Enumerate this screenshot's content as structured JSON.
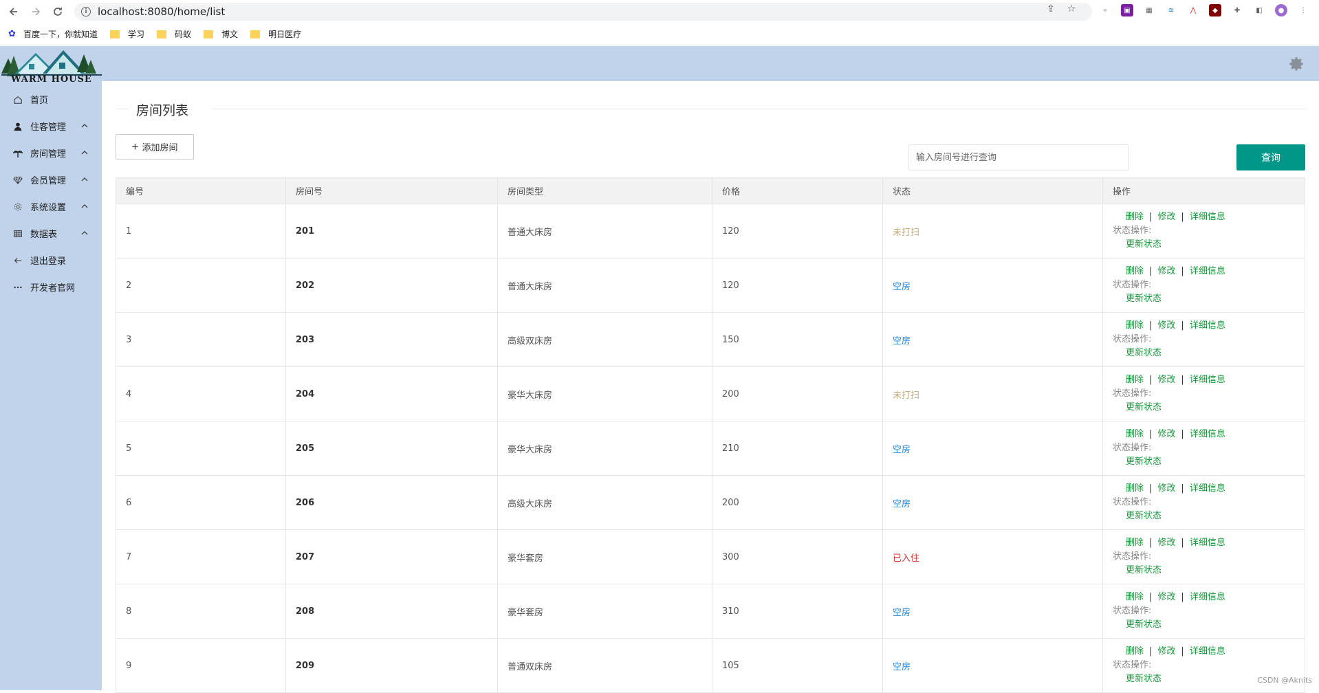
{
  "browser": {
    "url": "localhost:8080/home/list",
    "bookmarks": [
      "百度一下，你就知道",
      "学习",
      "码蚁",
      "博文",
      "明日医疗"
    ]
  },
  "app": {
    "logo_text": "WARM HOUSE"
  },
  "sidebar": {
    "items": [
      {
        "label": "首页",
        "icon": "home-icon"
      },
      {
        "label": "住客管理",
        "icon": "user-icon"
      },
      {
        "label": "房间管理",
        "icon": "palm-icon"
      },
      {
        "label": "会员管理",
        "icon": "diamond-icon"
      },
      {
        "label": "系统设置",
        "icon": "gear-icon"
      },
      {
        "label": "数据表",
        "icon": "table-icon"
      },
      {
        "label": "退出登录",
        "icon": "arrow-left-icon"
      },
      {
        "label": "开发者官网",
        "icon": "more-icon"
      }
    ]
  },
  "main": {
    "title": "房间列表",
    "add_button": "添加房间",
    "search_placeholder": "输入房间号进行查询",
    "search_button": "查询",
    "columns": [
      "编号",
      "房间号",
      "房间类型",
      "价格",
      "状态",
      "操作"
    ],
    "ops": {
      "delete": "删除",
      "edit": "修改",
      "detail": "详细信息",
      "state_label": "状态操作:",
      "update": "更新状态"
    },
    "rows": [
      {
        "id": "1",
        "room": "201",
        "type": "普通大床房",
        "price": "120",
        "status": "未打扫",
        "cls": "st-dirty"
      },
      {
        "id": "2",
        "room": "202",
        "type": "普通大床房",
        "price": "120",
        "status": "空房",
        "cls": "st-empty"
      },
      {
        "id": "3",
        "room": "203",
        "type": "高级双床房",
        "price": "150",
        "status": "空房",
        "cls": "st-empty"
      },
      {
        "id": "4",
        "room": "204",
        "type": "豪华大床房",
        "price": "200",
        "status": "未打扫",
        "cls": "st-dirty"
      },
      {
        "id": "5",
        "room": "205",
        "type": "豪华大床房",
        "price": "210",
        "status": "空房",
        "cls": "st-empty"
      },
      {
        "id": "6",
        "room": "206",
        "type": "高级大床房",
        "price": "200",
        "status": "空房",
        "cls": "st-empty"
      },
      {
        "id": "7",
        "room": "207",
        "type": "豪华套房",
        "price": "300",
        "status": "已入住",
        "cls": "st-occupied"
      },
      {
        "id": "8",
        "room": "208",
        "type": "豪华套房",
        "price": "310",
        "status": "空房",
        "cls": "st-empty"
      },
      {
        "id": "9",
        "room": "209",
        "type": "普通双床房",
        "price": "105",
        "status": "空房",
        "cls": "st-empty"
      }
    ]
  },
  "watermark": "CSDN @Aknits",
  "colors": {
    "sidebar_bg": "#c0d3ea",
    "primary": "#009688",
    "link": "#159a3a"
  }
}
